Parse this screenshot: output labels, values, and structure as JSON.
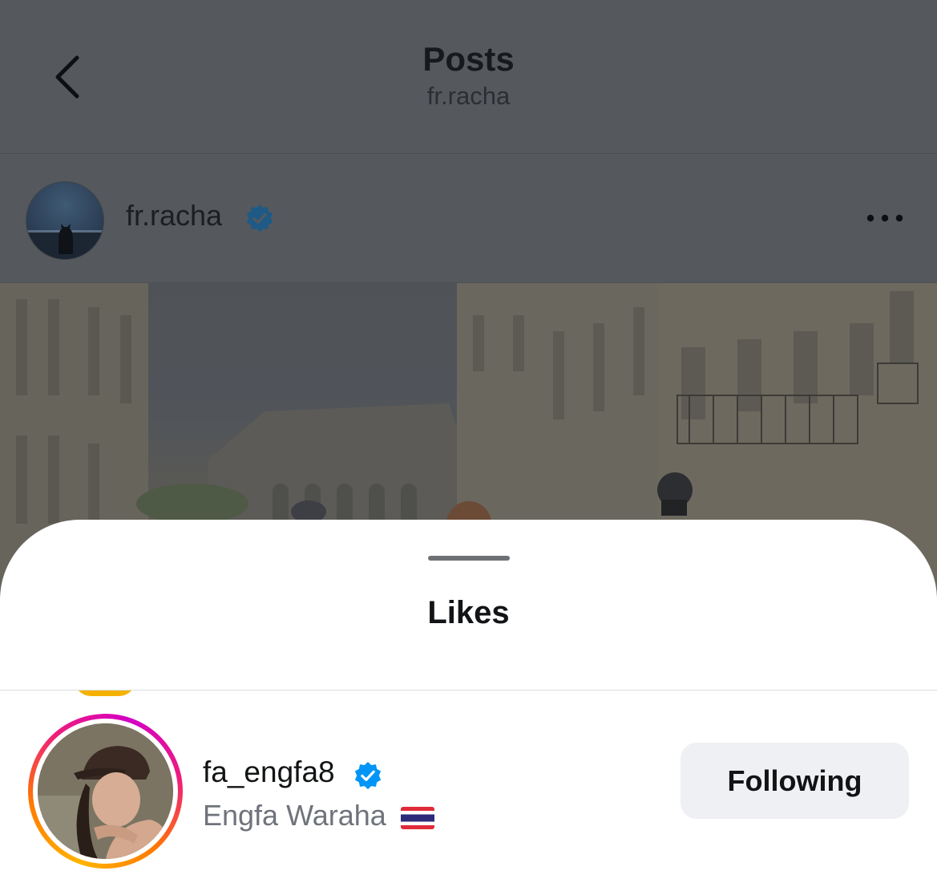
{
  "header": {
    "title": "Posts",
    "subtitle": "fr.racha"
  },
  "post": {
    "username": "fr.racha",
    "verified": true
  },
  "likes_sheet": {
    "title": "Likes",
    "items": [
      {
        "username": "fa_engfa8",
        "verified": true,
        "full_name": "Engfa Waraha",
        "flag": "thailand-flag",
        "button_label": "Following"
      }
    ]
  },
  "colors": {
    "verified_blue": "#0095f6",
    "overlay": "#55585d",
    "button_bg": "#eff0f3"
  }
}
